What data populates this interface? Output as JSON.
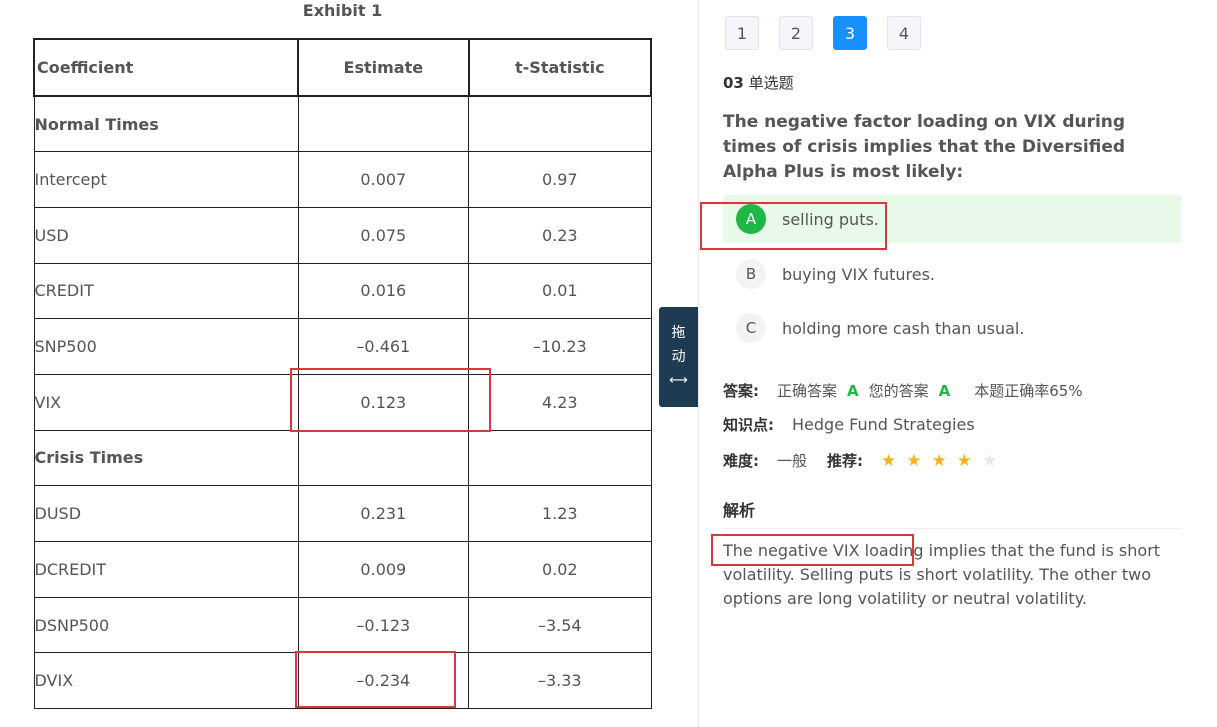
{
  "exhibit": {
    "title": "Exhibit 1",
    "headers": [
      "Coefficient",
      "Estimate",
      "t-Statistic"
    ],
    "sections": {
      "normal": "Normal Times",
      "crisis": "Crisis Times"
    },
    "normal_rows": [
      {
        "coef": "Intercept",
        "estimate": "0.007",
        "tstat": "0.97"
      },
      {
        "coef": "USD",
        "estimate": "0.075",
        "tstat": "0.23"
      },
      {
        "coef": "CREDIT",
        "estimate": "0.016",
        "tstat": "0.01"
      },
      {
        "coef": "SNP500",
        "estimate": "–0.461",
        "tstat": "–10.23"
      },
      {
        "coef": "VIX",
        "estimate": "0.123",
        "tstat": "4.23"
      }
    ],
    "crisis_rows": [
      {
        "coef": "DUSD",
        "estimate": "0.231",
        "tstat": "1.23"
      },
      {
        "coef": "DCREDIT",
        "estimate": "0.009",
        "tstat": "0.02"
      },
      {
        "coef": "DSNP500",
        "estimate": "–0.123",
        "tstat": "–3.54"
      },
      {
        "coef": "DVIX",
        "estimate": "–0.234",
        "tstat": "–3.33"
      }
    ]
  },
  "drag_handle": {
    "line1": "拖",
    "line2": "动",
    "icon": "⟷"
  },
  "pagination": {
    "pages": [
      "1",
      "2",
      "3",
      "4"
    ],
    "active": "3"
  },
  "question": {
    "number": "03",
    "type": "单选题",
    "text": "The negative factor loading on VIX during times of crisis implies that the Diversified Alpha Plus is most likely:",
    "options": [
      {
        "letter": "A",
        "text": "selling puts."
      },
      {
        "letter": "B",
        "text": "buying VIX futures."
      },
      {
        "letter": "C",
        "text": "holding more cash than usual."
      }
    ]
  },
  "answer": {
    "label": "答案:",
    "correct_label": "正确答案",
    "correct_value": "A",
    "yours_label": "您的答案",
    "yours_value": "A",
    "accuracy": "本题正确率65%"
  },
  "knowledge": {
    "label": "知识点:",
    "value": "Hedge Fund Strategies"
  },
  "difficulty": {
    "label": "难度:",
    "value": "一般",
    "recommend_label": "推荐:",
    "stars": 4,
    "max_stars": 5
  },
  "analysis": {
    "title": "解析",
    "text": "The negative VIX loading implies that the fund is short volatility. Selling puts is short volatility. The other two options are long volatility or neutral volatility."
  },
  "colors": {
    "accent": "#1890ff",
    "correct": "#1fb846",
    "highlight_box": "#d9363e",
    "handle": "#1d3b53"
  }
}
